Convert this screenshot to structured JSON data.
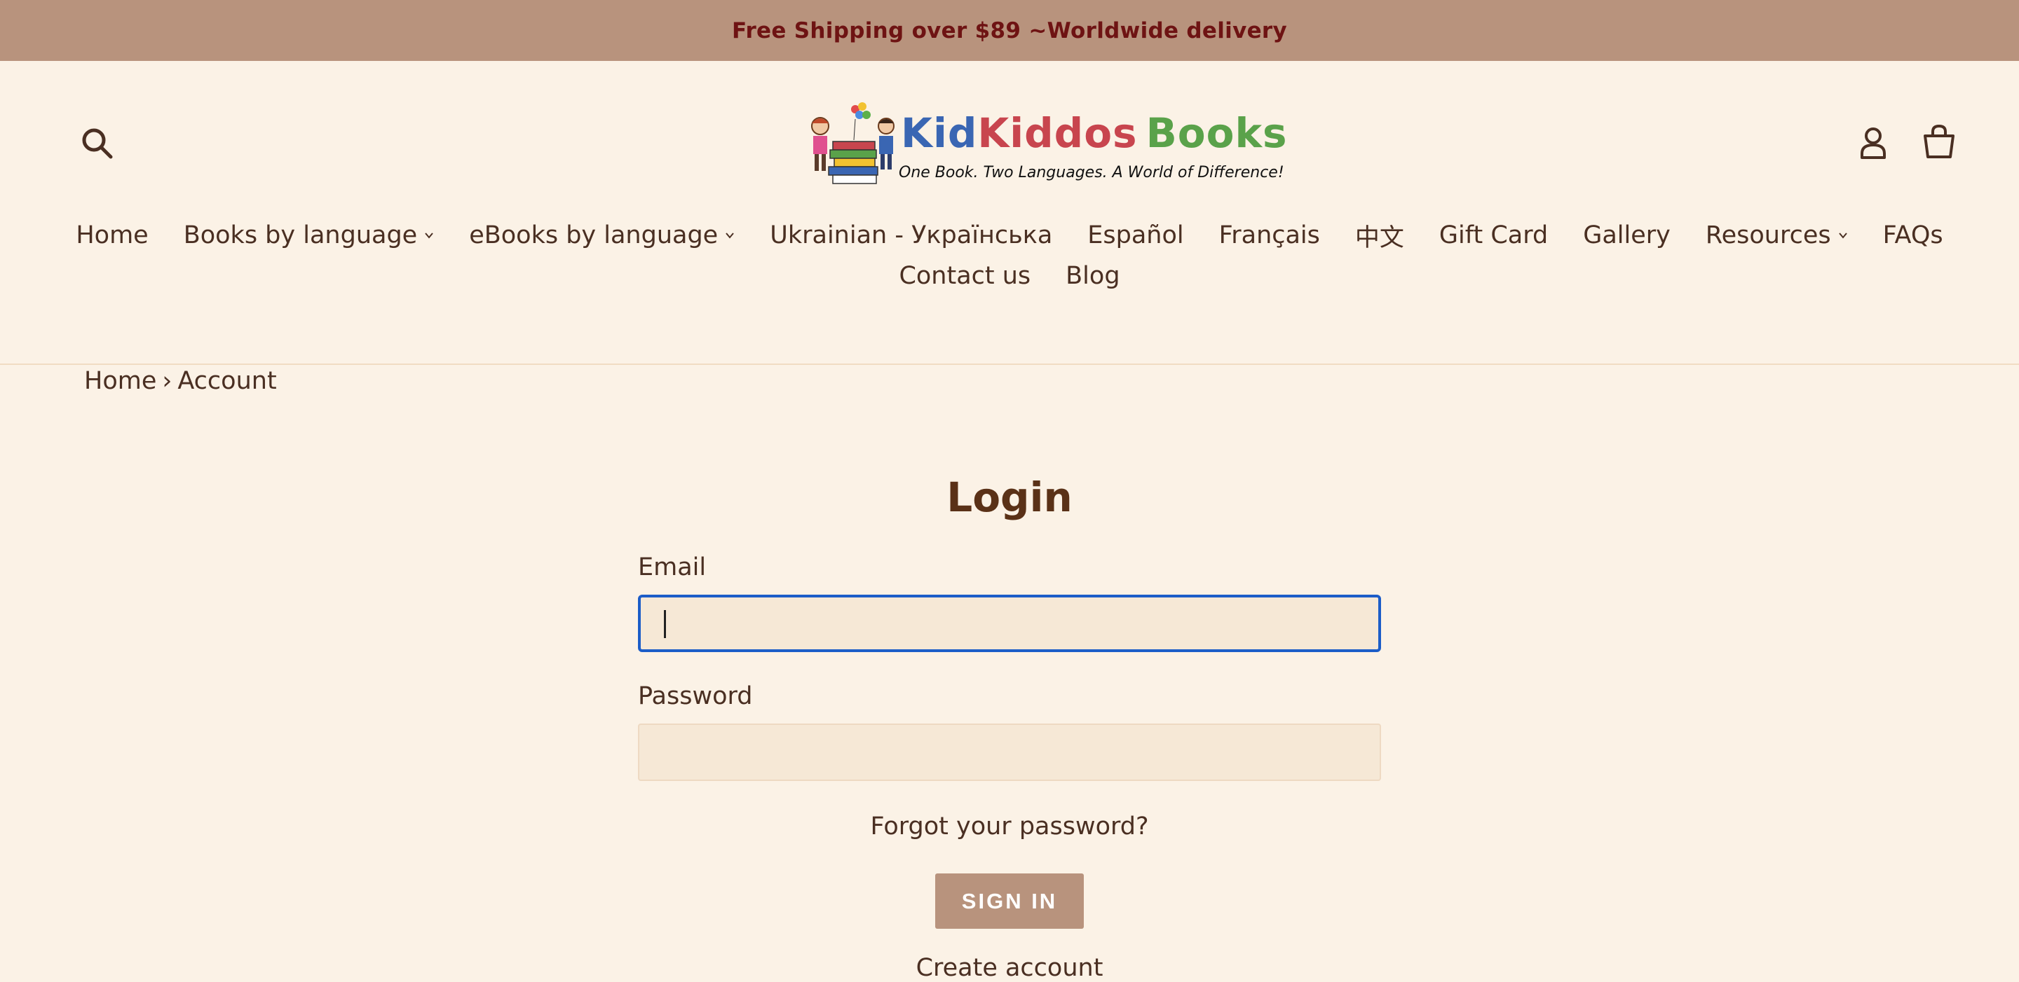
{
  "announcement": "Free Shipping over $89 ~Worldwide delivery",
  "header": {
    "logo": {
      "part1": "Kid",
      "part2": "Kiddos",
      "part3": "Books",
      "tagline": "One Book. Two Languages. A World of Difference!"
    },
    "icons": {
      "search": "search-icon",
      "account": "user-icon",
      "cart": "cart-icon"
    }
  },
  "nav": {
    "row1": [
      {
        "label": "Home"
      },
      {
        "label": "Books by language"
      },
      {
        "label": "eBooks by language"
      },
      {
        "label": "Ukrainian - Українська"
      },
      {
        "label": "Español"
      },
      {
        "label": "Français"
      },
      {
        "label": "中文"
      },
      {
        "label": "Gift Card"
      },
      {
        "label": "Gallery"
      },
      {
        "label": "Resources"
      },
      {
        "label": "FAQs"
      }
    ],
    "row2": [
      {
        "label": "Contact us"
      },
      {
        "label": "Blog"
      }
    ]
  },
  "breadcrumb": {
    "home": "Home",
    "separator": "›",
    "current": "Account"
  },
  "login": {
    "title": "Login",
    "email_label": "Email",
    "email_value": "",
    "password_label": "Password",
    "password_value": "",
    "forgot": "Forgot your password?",
    "signin": "SIGN IN",
    "create": "Create account"
  },
  "colors": {
    "background": "#fbf2e6",
    "announcement_bg": "#b8937d",
    "announcement_text": "#6e1313",
    "text": "#4a2f22",
    "focus_border": "#1c5dc8"
  }
}
